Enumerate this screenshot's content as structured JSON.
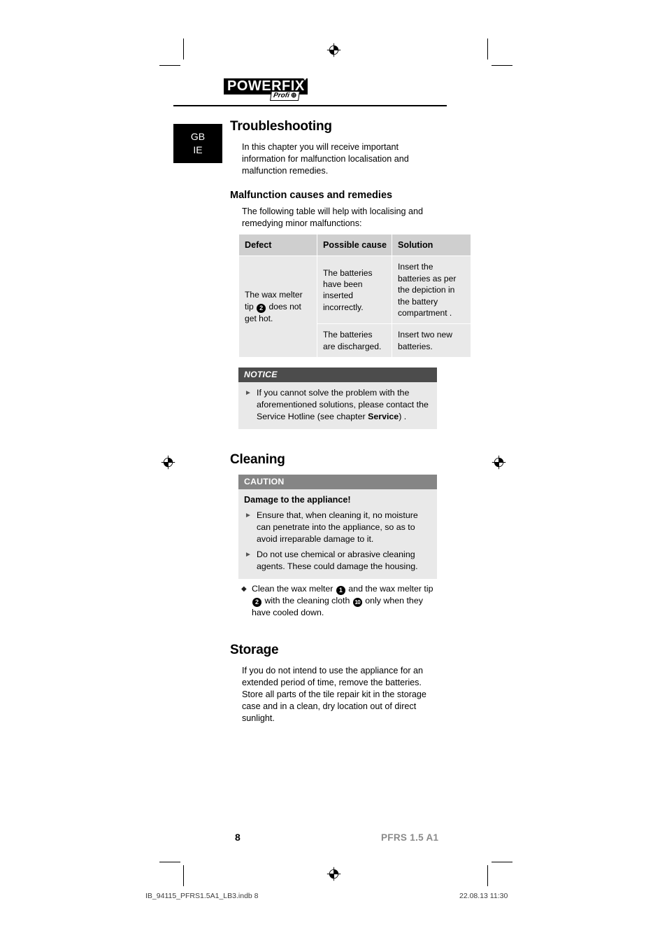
{
  "brand": {
    "logo_word": "POWERFIX",
    "logo_star": "*",
    "logo_sub": "Profi",
    "logo_sub_icon": "crosshair-icon"
  },
  "language_tab": {
    "line1": "GB",
    "line2": "IE"
  },
  "sections": {
    "troubleshooting": {
      "heading": "Troubleshooting",
      "intro": "In this chapter you will receive important information for malfunction localisation and malfunction remedies.",
      "subsection": {
        "heading": "Malfunction causes and remedies",
        "intro": "The following table will help with localising and remedying minor malfunctions:"
      },
      "table": {
        "headers": [
          "Defect",
          "Possible cause",
          "Solution"
        ],
        "rows": [
          {
            "defect_pre": "The wax melter tip ",
            "defect_badge": "2",
            "defect_post": " does not get hot.",
            "cause": "The batteries have been inserted incorrectly.",
            "solution": "Insert the batteries as per the depiction in the battery compartment ."
          },
          {
            "cause": "The batteries are discharged.",
            "solution": " Insert two new batteries."
          }
        ]
      },
      "notice": {
        "label": "NOTICE",
        "bullets": [
          {
            "marker": "triangle-right-icon",
            "text_pre": "If you cannot solve the problem with the aforementioned solutions, please contact the Service Hotline (see chapter ",
            "emphasis": "Service",
            "text_post": ") ."
          }
        ]
      }
    },
    "cleaning": {
      "heading": "Cleaning",
      "caution": {
        "label": "CAUTION",
        "title": "Damage to the appliance!",
        "bullets": [
          {
            "marker": "triangle-right-icon",
            "text": "Ensure that, when cleaning it, no moisture can penetrate into the appliance, so as to avoid irreparable damage to it."
          },
          {
            "marker": "triangle-right-icon",
            "text": "Do not use chemical or abrasive cleaning agents. These could damage the housing."
          }
        ]
      },
      "outside_bullets": [
        {
          "marker": "diamond-icon",
          "part1": "Clean the wax melter ",
          "badge1": "1",
          "part2": " and the wax melter tip ",
          "badge2": "2",
          "part3": " with the cleaning cloth ",
          "badge3": "10",
          "part4": " only when they have cooled down."
        }
      ]
    },
    "storage": {
      "heading": "Storage",
      "body": "If you do not intend to use the appliance for an extended period of time, remove the batteries. Store all parts of the tile repair kit in the storage case and in a clean, dry location out of direct sunlight."
    }
  },
  "footer": {
    "page_number": "8",
    "model": "PFRS 1.5 A1",
    "print_file": "IB_94115_PFRS1.5A1_LB3.indb   8",
    "print_date": "22.08.13   11:30"
  },
  "colors": {
    "notice_header_bg": "#4c4c4c",
    "caution_header_bg": "#858585",
    "callout_body_bg": "#e9e9e9",
    "table_header_bg": "#cfcfcf",
    "table_body_bg": "#e9e9e9",
    "model_text": "#8a8a8a"
  }
}
